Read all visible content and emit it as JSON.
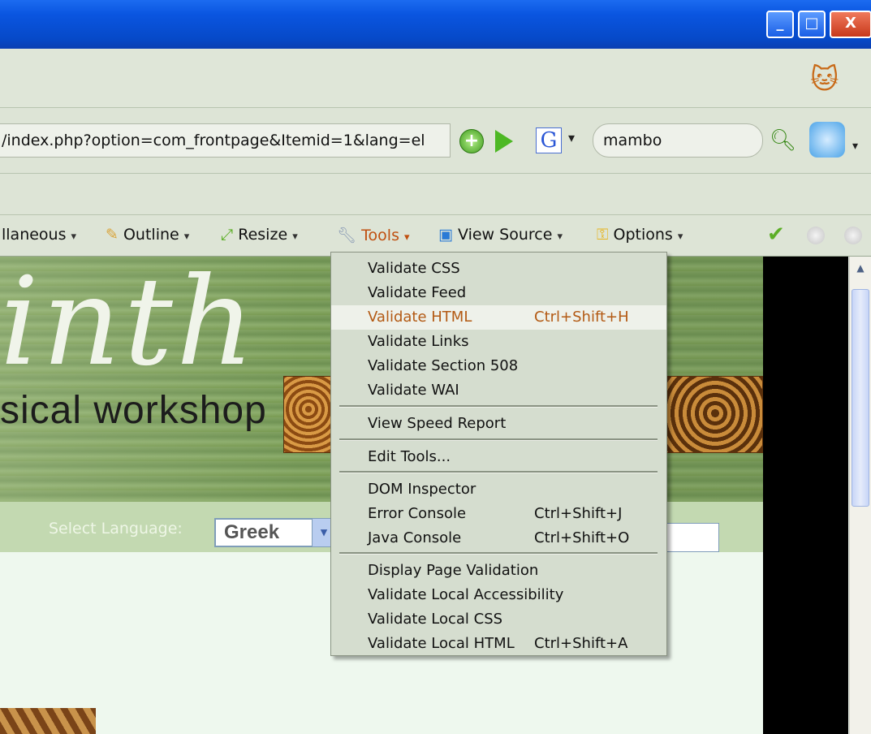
{
  "window": {
    "minimize_glyph": "_",
    "maximize_glyph": "□",
    "close_glyph": "X"
  },
  "navbar": {
    "url": "/index.php?option=com_frontpage&Itemid=1&lang=el",
    "plus_glyph": "+",
    "search_engine_glyph": "G",
    "search_value": "mambo",
    "dropdown_glyph": "▾"
  },
  "webdev_toolbar": {
    "miscellaneous": "llaneous",
    "outline": "Outline",
    "resize": "Resize",
    "tools": "Tools",
    "view_source": "View Source",
    "options": "Options",
    "arrow": "▾",
    "check_glyph": "✔"
  },
  "page": {
    "script_title": "inth",
    "subtitle": "sical   workshop",
    "select_language_label": "Select Language:",
    "language_value": "Greek",
    "select_arrow": "▾",
    "scroll_up_glyph": "▲"
  },
  "tools_menu": {
    "items": [
      {
        "label": "Validate CSS",
        "shortcut": ""
      },
      {
        "label": "Validate Feed",
        "shortcut": ""
      },
      {
        "label": "Validate HTML",
        "shortcut": "Ctrl+Shift+H"
      },
      {
        "label": "Validate Links",
        "shortcut": ""
      },
      {
        "label": "Validate Section 508",
        "shortcut": ""
      },
      {
        "label": "Validate WAI",
        "shortcut": ""
      },
      {
        "label": "View Speed Report",
        "shortcut": ""
      },
      {
        "label": "Edit Tools...",
        "shortcut": ""
      },
      {
        "label": "DOM Inspector",
        "shortcut": ""
      },
      {
        "label": "Error Console",
        "shortcut": "Ctrl+Shift+J"
      },
      {
        "label": "Java Console",
        "shortcut": "Ctrl+Shift+O"
      },
      {
        "label": "Display Page Validation",
        "shortcut": ""
      },
      {
        "label": "Validate Local Accessibility",
        "shortcut": ""
      },
      {
        "label": "Validate Local CSS",
        "shortcut": ""
      },
      {
        "label": "Validate Local HTML",
        "shortcut": "Ctrl+Shift+A"
      }
    ]
  }
}
